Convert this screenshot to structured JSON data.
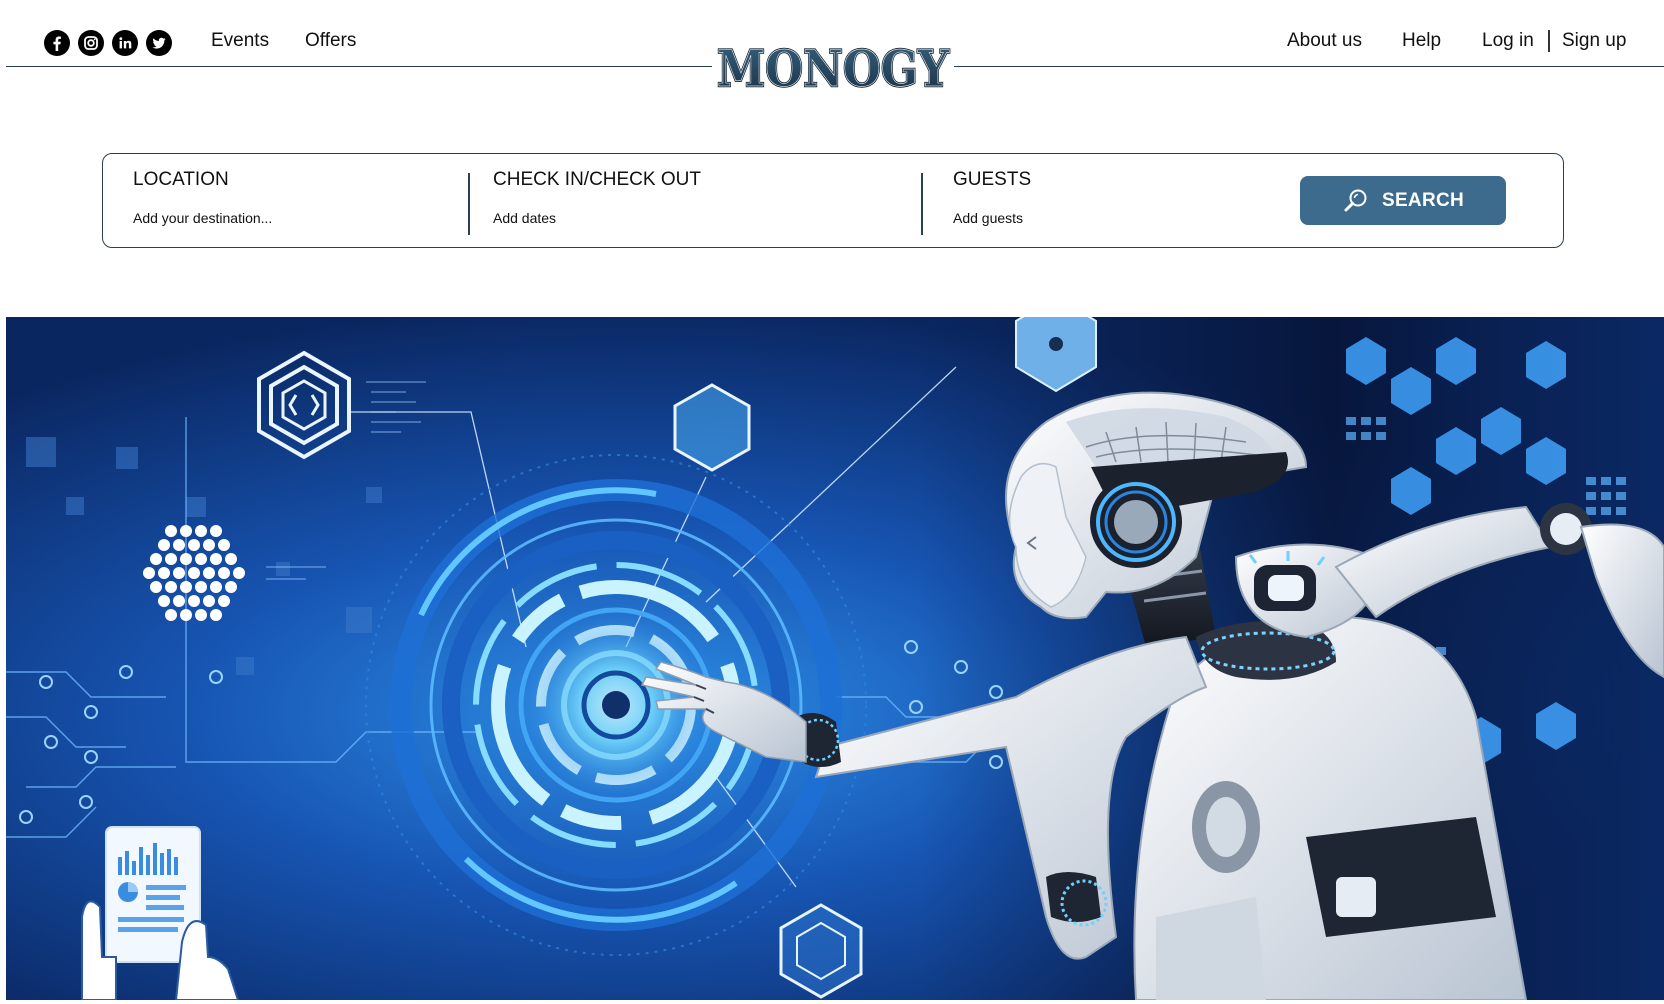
{
  "header": {
    "social": [
      "facebook-icon",
      "instagram-icon",
      "linkedin-icon",
      "twitter-icon"
    ],
    "nav_left": {
      "events": "Events",
      "offers": "Offers"
    },
    "logo": "MONOGY",
    "nav_right": {
      "about": "About us",
      "help": "Help",
      "login": "Log in",
      "signup": "Sign up"
    }
  },
  "search": {
    "location": {
      "title": "LOCATION",
      "placeholder": "Add your destination..."
    },
    "dates": {
      "title": "CHECK IN/CHECK OUT",
      "placeholder": "Add dates"
    },
    "guests": {
      "title": "GUESTS",
      "placeholder": "Add guests"
    },
    "button": {
      "label": "SEARCH",
      "icon": "search-icon"
    }
  },
  "colors": {
    "accent": "#3d6b8e",
    "border": "#2c3e57",
    "hero_bg": "#0a2c6e"
  }
}
